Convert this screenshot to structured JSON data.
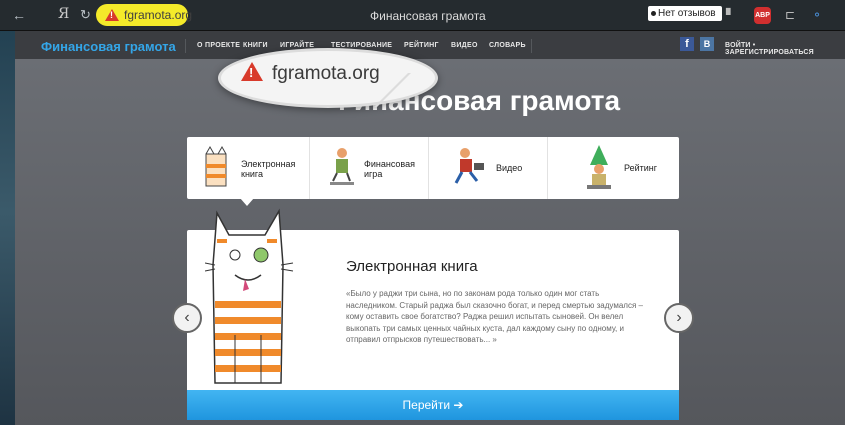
{
  "browser": {
    "back_glyph": "←",
    "yandex_glyph": "Я",
    "reload_glyph": "↻",
    "url": "fgramota.org",
    "tab_title": "Финансовая грамота",
    "reviews_label": "Нет отзывов",
    "abp_label": "ABP",
    "bookmark_glyph": "▘",
    "ext_glyph": "⊏",
    "more_glyph": "⚬"
  },
  "site_nav": {
    "brand": "Финансовая грамота",
    "items": [
      {
        "label": "О ПРОЕКТЕ"
      },
      {
        "label": "КНИГИ"
      },
      {
        "label": "ИГРАЙТЕ"
      },
      {
        "label": "ТЕСТИРОВАНИЕ"
      },
      {
        "label": "РЕЙТИНГ"
      },
      {
        "label": "ВИДЕО"
      },
      {
        "label": "СЛОВАРЬ"
      }
    ],
    "fb_label": "f",
    "vk_label": "B",
    "login_label": "ВОЙТИ • ЗАРЕГИСТРИРОВАТЬСЯ"
  },
  "magnifier": {
    "url": "fgramota.org"
  },
  "main": {
    "heading": "Финансовая грамота",
    "categories": [
      {
        "label": "Электронная книга"
      },
      {
        "label": "Финансовая игра"
      },
      {
        "label": "Видео"
      },
      {
        "label": "Рейтинг"
      }
    ],
    "card": {
      "title": "Электронная книга",
      "text": "«Было у раджи три сына, но по законам рода только один мог стать наследником. Старый раджа был сказочно богат, и перед смертью задумался – кому оставить свое богатство? Раджа решил испытать сыновей. Он велел выкопать три самых ценных чайных куста, дал каждому сыну по одному, и отправил отпрысков путешествовать... »",
      "button_label": "Перейти ➔",
      "prev_glyph": "‹",
      "next_glyph": "›"
    }
  },
  "colors": {
    "brand_blue": "#34a6e8",
    "button_blue": "#1f95de",
    "warning_red": "#d83a2b",
    "highlight_yellow": "#f4ea2a"
  }
}
